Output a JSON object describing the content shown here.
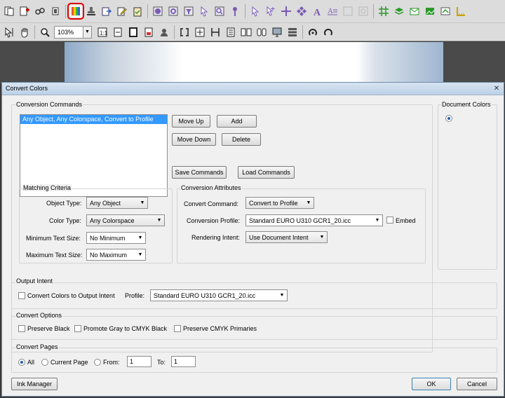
{
  "toolbar_top": {
    "icons": [
      "pages-icon",
      "insert-page-icon",
      "link-icon",
      "copy-icon",
      "convert-colors-icon",
      "stamp-icon",
      "export-icon",
      "edit-icon",
      "clipboard-icon",
      "globe-icon",
      "settings-icon",
      "filter-icon",
      "pointer-icon",
      "magnify-icon",
      "dropper-icon",
      "select-arrow-icon",
      "select-plus-icon",
      "move-icon",
      "diamond-icon",
      "text-icon",
      "text-lines-icon",
      "disabled-icon",
      "disabled2-icon",
      "grid-icon",
      "layers-icon",
      "mail-icon",
      "image-icon",
      "color-bar-icon",
      "ruler-icon"
    ]
  },
  "toolbar_bottom": {
    "zoom_value": "103%"
  },
  "dialog": {
    "title": "Convert Colors",
    "conversion_commands": {
      "label": "Conversion Commands",
      "items": [
        "Any Object, Any Colorspace, Convert to Profile"
      ],
      "move_up": "Move Up",
      "add": "Add",
      "move_down": "Move Down",
      "delete": "Delete",
      "save_commands": "Save Commands",
      "load_commands": "Load Commands"
    },
    "document_colors": {
      "label": "Document Colors"
    },
    "matching_criteria": {
      "label": "Matching Criteria",
      "object_type_label": "Object Type:",
      "object_type_value": "Any Object",
      "color_type_label": "Color Type:",
      "color_type_value": "Any Colorspace",
      "min_text_label": "Minimum Text Size:",
      "min_text_value": "No Minimum",
      "max_text_label": "Maximum Text Size:",
      "max_text_value": "No Maximum"
    },
    "conversion_attributes": {
      "label": "Conversion Attributes",
      "command_label": "Convert Command:",
      "command_value": "Convert to Profile",
      "profile_label": "Conversion Profile:",
      "profile_value": "Standard EURO U310 GCR1_20.icc",
      "embed_label": "Embed",
      "intent_label": "Rendering Intent:",
      "intent_value": "Use Document Intent"
    },
    "output_intent": {
      "label": "Output Intent",
      "convert_label": "Convert Colors to Output Intent",
      "profile_label": "Profile:",
      "profile_value": "Standard EURO U310 GCR1_20.icc"
    },
    "convert_options": {
      "label": "Convert Options",
      "preserve_black": "Preserve Black",
      "promote_gray": "Promote Gray to CMYK Black",
      "preserve_cmyk": "Preserve CMYK Primaries"
    },
    "convert_pages": {
      "label": "Convert Pages",
      "all": "All",
      "current_page": "Current Page",
      "from": "From:",
      "from_value": "1",
      "to": "To:",
      "to_value": "1"
    },
    "ink_manager": "Ink Manager",
    "ok": "OK",
    "cancel": "Cancel"
  }
}
